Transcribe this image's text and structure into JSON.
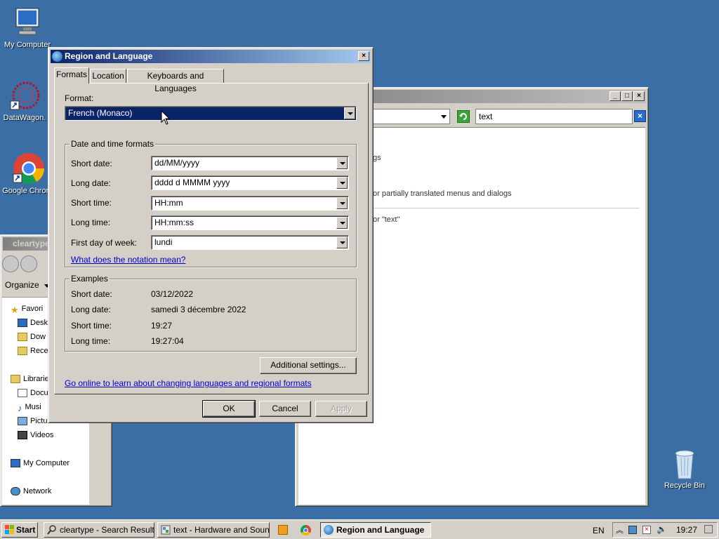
{
  "desktop": {
    "icons": [
      {
        "label": "My Computer"
      },
      {
        "label": "DataWagon."
      },
      {
        "label": "Google Chrom"
      },
      {
        "label": "Recycle Bin"
      }
    ]
  },
  "explorer": {
    "title": "cleartype",
    "organize": "Organize",
    "nav": [
      "Favori",
      "Desk",
      "Dow",
      "Rece",
      "Librarie",
      "Docu",
      "Musi",
      "Pictures",
      "Videos",
      "My Computer",
      "Network"
    ]
  },
  "control_panel": {
    "search_value": "text",
    "results": [
      "gs",
      "or partially translated menus and dialogs",
      "or \"text\""
    ]
  },
  "dialog": {
    "title": "Region and Language",
    "tabs": [
      "Formats",
      "Location",
      "Keyboards and Languages"
    ],
    "format_label": "Format:",
    "format_value": "French (Monaco)",
    "date_time_group": "Date and time formats",
    "fields": [
      {
        "label": "Short date:",
        "value": "dd/MM/yyyy"
      },
      {
        "label": "Long date:",
        "value": "dddd d MMMM yyyy"
      },
      {
        "label": "Short time:",
        "value": "HH:mm"
      },
      {
        "label": "Long time:",
        "value": "HH:mm:ss"
      },
      {
        "label": "First day of week:",
        "value": "lundi"
      }
    ],
    "notation_link": "What does the notation mean?",
    "examples_group": "Examples",
    "examples": [
      {
        "label": "Short date:",
        "value": "03/12/2022"
      },
      {
        "label": "Long date:",
        "value": "samedi 3 décembre 2022"
      },
      {
        "label": "Short time:",
        "value": "19:27"
      },
      {
        "label": "Long time:",
        "value": "19:27:04"
      }
    ],
    "additional_settings": "Additional settings...",
    "online_link": "Go online to learn about changing languages and regional formats",
    "ok": "OK",
    "cancel": "Cancel",
    "apply": "Apply"
  },
  "taskbar": {
    "start": "Start",
    "tasks": [
      {
        "label": "cleartype - Search Results"
      },
      {
        "label": "text - Hardware and Sound"
      },
      {
        "label": "Region and Language"
      }
    ],
    "language": "EN",
    "clock": "19:27"
  },
  "colors": {
    "desktop": "#3a6ea5",
    "title_active": "#0a246a",
    "selection": "#0a246a",
    "link": "#0000cc"
  }
}
